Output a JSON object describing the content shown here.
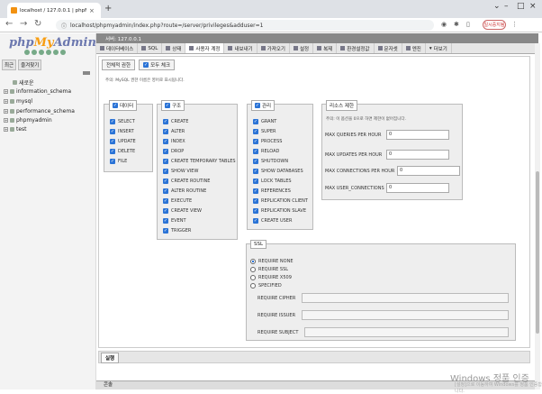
{
  "browser": {
    "tab_title": "localhost / 127.0.0.1 | phpMyA",
    "url": "localhost/phpmyadmin/index.php?route=/server/privileges&adduser=1",
    "pause_label": "일시중지됨"
  },
  "sidebar": {
    "logo_php": "php",
    "logo_my": "My",
    "logo_admin": "Admin",
    "tab_recent": "최근",
    "tab_favorites": "즐겨찾기",
    "new_label": "새로운",
    "databases": [
      "information_schema",
      "mysql",
      "performance_schema",
      "phpmyadmin",
      "test"
    ]
  },
  "menubar": {
    "server": "서버: 127.0.0.1"
  },
  "tabs": [
    "데이터베이스",
    "SQL",
    "상태",
    "사용자 계정",
    "내보내기",
    "가져오기",
    "설정",
    "복제",
    "환경설정값",
    "문자셋",
    "엔진",
    "더보기"
  ],
  "subtabs": {
    "global": "전체적 권한",
    "checkall": "모두 체크"
  },
  "note_global": "주의: MySQL 권한 이름은 영어로 표시됩니다.",
  "groups": {
    "data": {
      "title": "데이터",
      "items": [
        "SELECT",
        "INSERT",
        "UPDATE",
        "DELETE",
        "FILE"
      ]
    },
    "structure": {
      "title": "구조",
      "items": [
        "CREATE",
        "ALTER",
        "INDEX",
        "DROP",
        "CREATE TEMPORARY TABLES",
        "SHOW VIEW",
        "CREATE ROUTINE",
        "ALTER ROUTINE",
        "EXECUTE",
        "CREATE VIEW",
        "EVENT",
        "TRIGGER"
      ]
    },
    "admin": {
      "title": "관리",
      "items": [
        "GRANT",
        "SUPER",
        "PROCESS",
        "RELOAD",
        "SHUTDOWN",
        "SHOW DATABASES",
        "LOCK TABLES",
        "REFERENCES",
        "REPLICATION CLIENT",
        "REPLICATION SLAVE",
        "CREATE USER"
      ]
    }
  },
  "resources": {
    "title": "리소스 제한",
    "note": "주의: 이 옵션을 0으로 하면 제한이 없어집니다.",
    "items": [
      {
        "label": "MAX QUERIES PER HOUR",
        "value": "0"
      },
      {
        "label": "MAX UPDATES PER HOUR",
        "value": "0"
      },
      {
        "label": "MAX CONNECTIONS PER HOUR",
        "value": "0"
      },
      {
        "label": "MAX USER_CONNECTIONS",
        "value": "0"
      }
    ]
  },
  "ssl": {
    "title": "SSL",
    "options": [
      "REQUIRE NONE",
      "REQUIRE SSL",
      "REQUIRE X509",
      "SPECIFIED"
    ],
    "selected": "REQUIRE NONE",
    "fields": [
      "REQUIRE CIPHER",
      "REQUIRE ISSUER",
      "REQUIRE SUBJECT"
    ]
  },
  "footer": {
    "go_label": "실행",
    "console_label": "콘솔"
  },
  "watermark": {
    "line1": "Windows 정품 인증",
    "line2": "[설정]으로 이동하여 Windows를 정품 인증합니다."
  }
}
